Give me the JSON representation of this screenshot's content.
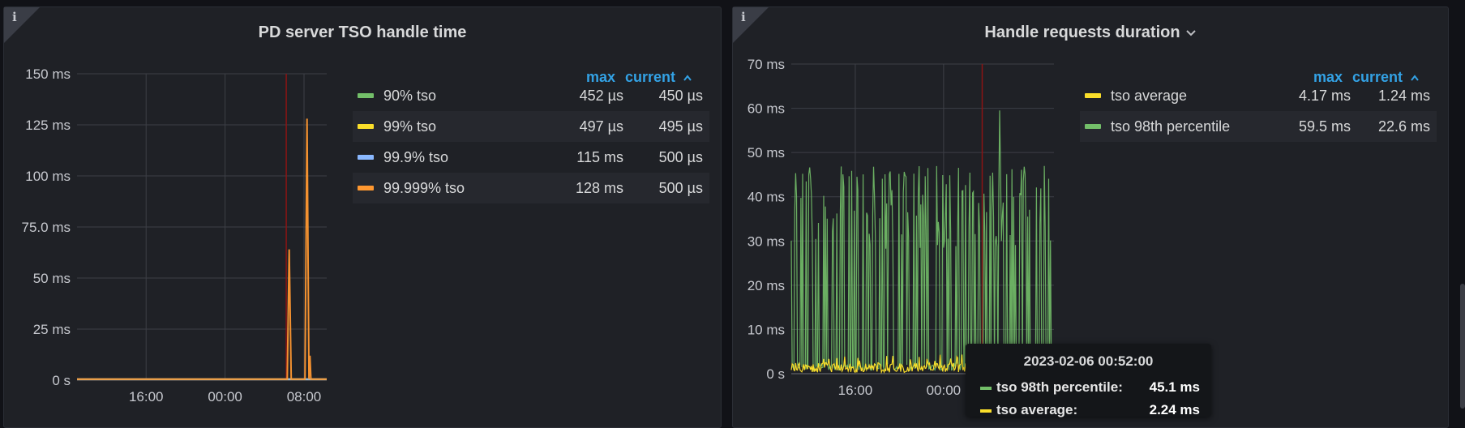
{
  "panels": {
    "left": {
      "title": "PD server TSO handle time",
      "info_glyph": "i",
      "legend": {
        "max_label": "max",
        "current_label": "current",
        "sort_icon": "chevron-up-icon",
        "rows": [
          {
            "name": "90% tso",
            "max": "452 µs",
            "current": "450 µs",
            "color": "#73bf69"
          },
          {
            "name": "99% tso",
            "max": "497 µs",
            "current": "495 µs",
            "color": "#fade2a"
          },
          {
            "name": "99.9% tso",
            "max": "115 ms",
            "current": "500 µs",
            "color": "#8ab8ff"
          },
          {
            "name": "99.999% tso",
            "max": "128 ms",
            "current": "500 µs",
            "color": "#ff9830"
          }
        ]
      }
    },
    "right": {
      "title": "Handle requests duration",
      "title_icon": "chevron-down-icon",
      "info_glyph": "i",
      "legend": {
        "max_label": "max",
        "current_label": "current",
        "sort_icon": "chevron-up-icon",
        "rows": [
          {
            "name": "tso average",
            "max": "4.17 ms",
            "current": "1.24 ms",
            "color": "#fade2a"
          },
          {
            "name": "tso 98th percentile",
            "max": "59.5 ms",
            "current": "22.6 ms",
            "color": "#73bf69"
          }
        ]
      }
    }
  },
  "tooltip": {
    "time": "2023-02-06 00:52:00",
    "rows": [
      {
        "name": "tso 98th percentile:",
        "value": "45.1 ms",
        "color": "#73bf69"
      },
      {
        "name": "tso average:",
        "value": "2.24 ms",
        "color": "#fade2a"
      }
    ]
  },
  "chart_data": [
    {
      "type": "line",
      "title": "PD server TSO handle time",
      "y_ticks": [
        "0 s",
        "25 ms",
        "50 ms",
        "75.0 ms",
        "100 ms",
        "125 ms",
        "150 ms"
      ],
      "ylim_ms": [
        0,
        150
      ],
      "x_ticks": [
        "16:00",
        "00:00",
        "08:00"
      ],
      "x_hours": [
        16,
        24,
        32
      ],
      "x_range_hours": [
        9,
        34.3
      ],
      "grid": true,
      "legend": "right",
      "series": [
        {
          "name": "90% tso",
          "color": "#73bf69",
          "points_ms": [
            [
              9,
              0.45
            ],
            [
              34.3,
              0.45
            ]
          ]
        },
        {
          "name": "99% tso",
          "color": "#fade2a",
          "points_ms": [
            [
              9,
              0.5
            ],
            [
              34.3,
              0.5
            ]
          ]
        },
        {
          "name": "99.9% tso",
          "color": "#8ab8ff",
          "points_ms": [
            [
              9,
              0.5
            ],
            [
              34.3,
              0.5
            ]
          ]
        },
        {
          "name": "99.999% tso",
          "color": "#ff9830",
          "points_ms": [
            [
              9,
              0.5
            ],
            [
              30.3,
              0.5
            ],
            [
              30.5,
              64
            ],
            [
              30.7,
              0.5
            ],
            [
              32.1,
              0.5
            ],
            [
              32.3,
              128
            ],
            [
              32.5,
              0.5
            ],
            [
              32.6,
              12
            ],
            [
              32.7,
              0.5
            ],
            [
              34.3,
              0.5
            ]
          ]
        }
      ],
      "annotation_hour": 30.2
    },
    {
      "type": "line",
      "title": "Handle requests duration",
      "y_ticks": [
        "0 s",
        "10 ms",
        "20 ms",
        "30 ms",
        "40 ms",
        "50 ms",
        "60 ms",
        "70 ms"
      ],
      "ylim_ms": [
        0,
        70
      ],
      "x_ticks": [
        "16:00",
        "00:00"
      ],
      "x_hours": [
        16,
        24
      ],
      "x_range_hours": [
        10.2,
        34
      ],
      "grid": true,
      "legend": "right",
      "series": [
        {
          "name": "tso 98th percentile",
          "color": "#73bf69"
        },
        {
          "name": "tso average",
          "color": "#fade2a"
        }
      ],
      "annotation_hour": 27.5
    }
  ]
}
